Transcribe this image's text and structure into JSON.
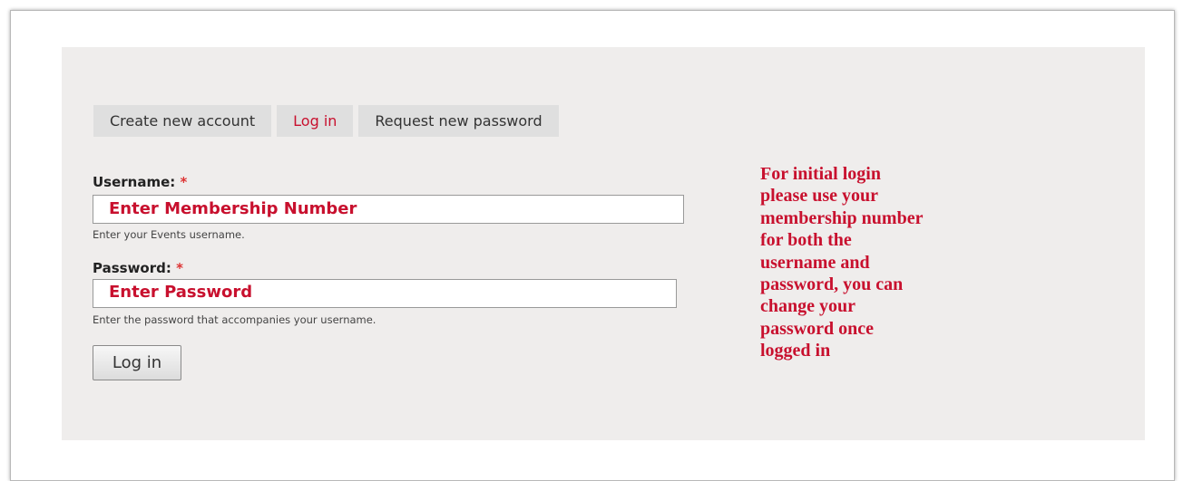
{
  "tabs": [
    {
      "label": "Create new account",
      "active": false
    },
    {
      "label": "Log in",
      "active": true
    },
    {
      "label": "Request new password",
      "active": false
    }
  ],
  "username": {
    "label": "Username:",
    "required_mark": "*",
    "value": "Enter Membership Number",
    "description": "Enter your Events username."
  },
  "password": {
    "label": "Password:",
    "required_mark": "*",
    "value": "Enter Password",
    "description": "Enter the password that accompanies your username."
  },
  "submit_label": "Log in",
  "note": "For initial login\nplease use your\nmembership number\nfor both the\nusername and\npassword, you can\nchange your\npassword once\nlogged in",
  "colors": {
    "panel_bg": "#efedec",
    "tab_bg": "#dfdfdf",
    "accent_red": "#c8102e"
  }
}
